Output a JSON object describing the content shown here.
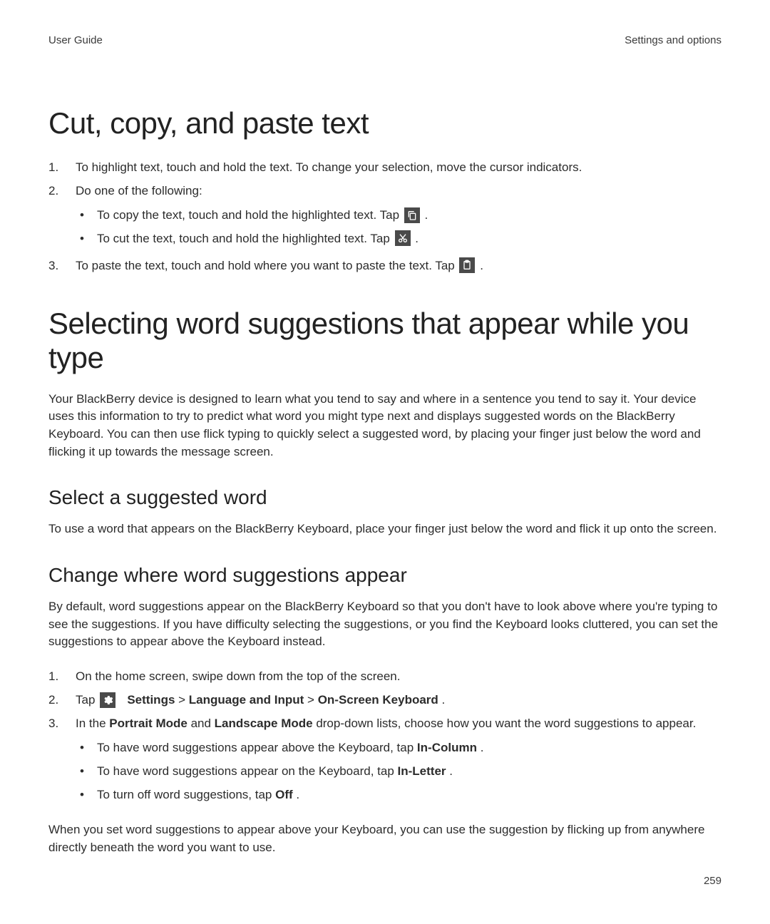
{
  "header": {
    "left": "User Guide",
    "right": "Settings and options"
  },
  "section1": {
    "title": "Cut, copy, and paste text",
    "step1": "To highlight text, touch and hold the text. To change your selection, move the cursor indicators.",
    "step2": "Do one of the following:",
    "bullet1_pre": "To copy the text, touch and hold the highlighted text. Tap ",
    "bullet1_post": " .",
    "bullet2_pre": "To cut the text, touch and hold the highlighted text. Tap ",
    "bullet2_post": " .",
    "step3_pre": "To paste the text, touch and hold where you want to paste the text. Tap ",
    "step3_post": " ."
  },
  "section2": {
    "title": "Selecting word suggestions that appear while you type",
    "intro": "Your BlackBerry device is designed to learn what you tend to say and where in a sentence you tend to say it. Your device uses this information to try to predict what word you might type next and displays suggested words on the BlackBerry Keyboard. You can then use flick typing to quickly select a suggested word, by placing your finger just below the word and flicking it up towards the message screen.",
    "sub1_title": "Select a suggested word",
    "sub1_body": "To use a word that appears on the BlackBerry Keyboard, place your finger just below the word and flick it up onto the screen.",
    "sub2_title": "Change where word suggestions appear",
    "sub2_body": "By default, word suggestions appear on the BlackBerry Keyboard so that you don't have to look above where you're typing to see the suggestions. If you have difficulty selecting the suggestions, or you find the Keyboard looks cluttered, you can set the suggestions to appear above the Keyboard instead.",
    "sub2_step1": "On the home screen, swipe down from the top of the screen.",
    "sub2_step2_pre": "Tap ",
    "sub2_step2_b1": "Settings",
    "sub2_step2_gt1": " > ",
    "sub2_step2_b2": "Language and Input",
    "sub2_step2_gt2": " > ",
    "sub2_step2_b3": "On-Screen Keyboard",
    "sub2_step2_post": ".",
    "sub2_step3_pre": "In the ",
    "sub2_step3_b1": "Portrait Mode",
    "sub2_step3_and": " and ",
    "sub2_step3_b2": "Landscape Mode",
    "sub2_step3_post": " drop-down lists, choose how you want the word suggestions to appear.",
    "sub2_bullet1_pre": "To have word suggestions appear above the Keyboard, tap ",
    "sub2_bullet1_b": "In-Column",
    "sub2_bullet1_post": ".",
    "sub2_bullet2_pre": "To have word suggestions appear on the Keyboard, tap ",
    "sub2_bullet2_b": "In-Letter",
    "sub2_bullet2_post": ".",
    "sub2_bullet3_pre": "To turn off word suggestions, tap ",
    "sub2_bullet3_b": "Off",
    "sub2_bullet3_post": ".",
    "sub2_outro": "When you set word suggestions to appear above your Keyboard, you can use the suggestion by flicking up from anywhere directly beneath the word you want to use."
  },
  "page_number": "259",
  "nums": {
    "n1": "1.",
    "n2": "2.",
    "n3": "3."
  },
  "bullet": "•"
}
